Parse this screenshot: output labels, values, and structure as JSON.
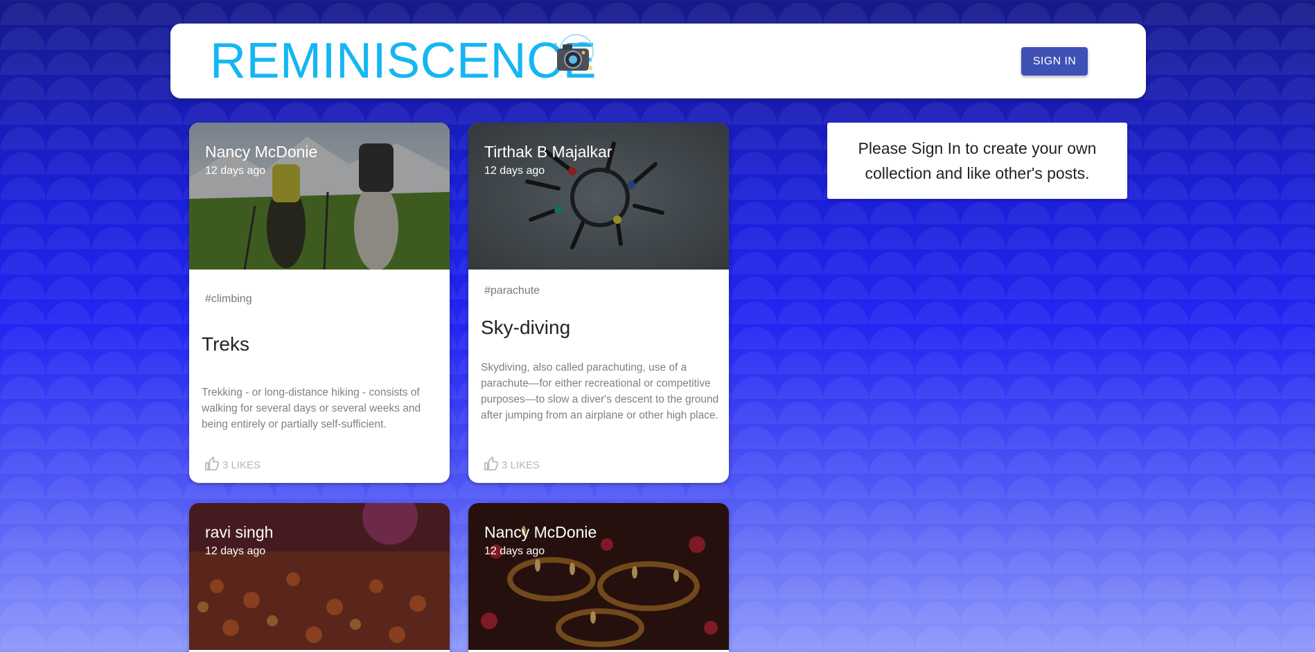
{
  "header": {
    "brand_title": "REMINISCENCE",
    "logo_icon": "camera-icon",
    "sign_in_label": "SIGN IN"
  },
  "posts": [
    {
      "author": "Nancy McDonie",
      "time": "12 days ago",
      "tags": "#climbing",
      "title": "Treks",
      "message": "Trekking - or long-distance hiking - consists of walking for several days or several weeks and being entirely or partially self-sufficient.",
      "likes_label": "3 LIKES",
      "like_icon": "thumb-up-icon"
    },
    {
      "author": "Tirthak B Majalkar",
      "time": "12 days ago",
      "tags": "#parachute",
      "title": "Sky-diving",
      "message": "Skydiving, also called parachuting, use of a parachute—for either recreational or competitive purposes—to slow a diver's descent to the ground after jumping from an airplane or other high place.",
      "likes_label": "3 LIKES",
      "like_icon": "thumb-up-icon"
    },
    {
      "author": "ravi singh",
      "time": "12 days ago"
    },
    {
      "author": "Nancy McDonie",
      "time": "12 days ago"
    }
  ],
  "sidebar": {
    "notice": "Please Sign In to create your own collection and like other's posts."
  },
  "colors": {
    "brand": "#15b6f2",
    "button": "#3f51b5",
    "background_top": "#15198a",
    "background_bottom": "#8e98fb"
  }
}
